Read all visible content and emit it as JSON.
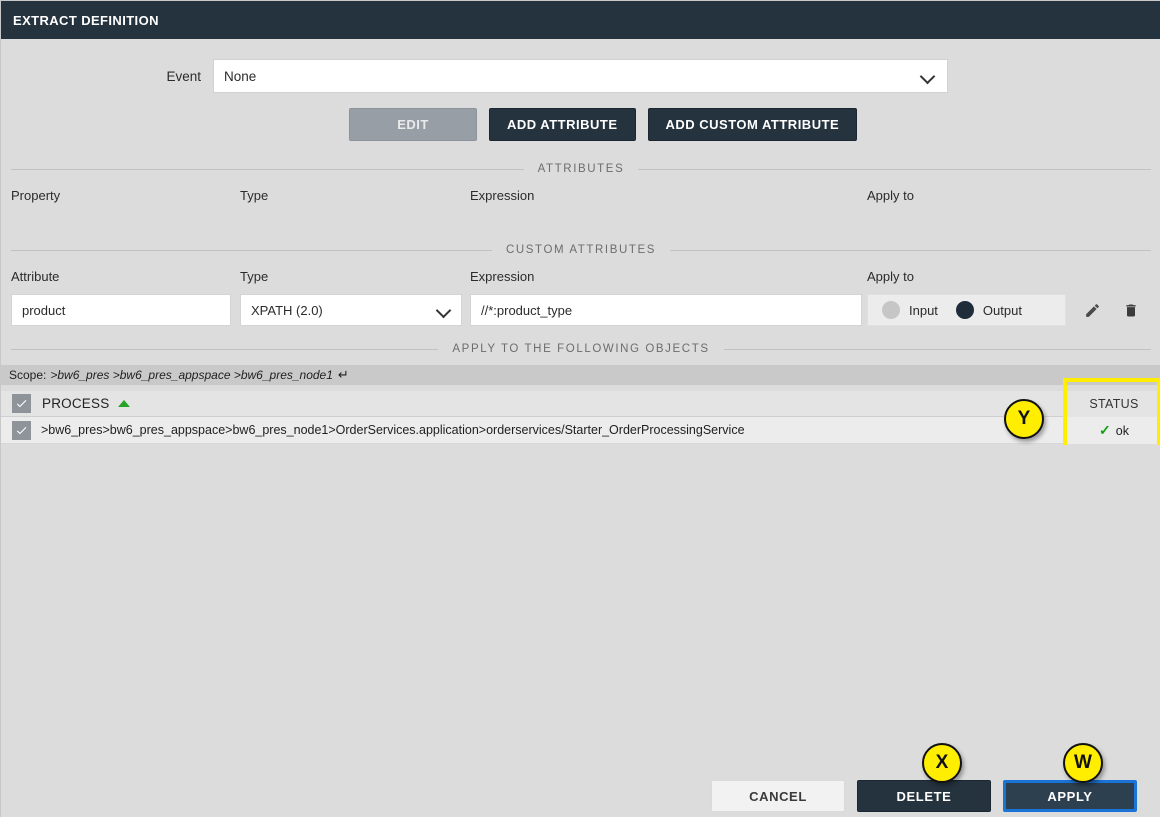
{
  "window": {
    "title": "EXTRACT DEFINITION"
  },
  "event": {
    "label": "Event",
    "value": "None",
    "chevron_icon": "chevron-down-icon"
  },
  "toolbar": {
    "edit_label": "EDIT",
    "add_attribute_label": "ADD ATTRIBUTE",
    "add_custom_attribute_label": "ADD CUSTOM ATTRIBUTE"
  },
  "attributes_section": {
    "caption": "ATTRIBUTES",
    "columns": [
      "Property",
      "Type",
      "Expression",
      "Apply to"
    ],
    "rows": []
  },
  "custom_attributes_section": {
    "caption": "CUSTOM ATTRIBUTES",
    "columns": [
      "Attribute",
      "Type",
      "Expression",
      "Apply to"
    ],
    "row": {
      "attribute": "product",
      "type": "XPATH (2.0)",
      "expression": "//*:product_type",
      "apply_to": {
        "input_label": "Input",
        "output_label": "Output",
        "selected": "Output"
      },
      "edit_icon": "pencil-icon",
      "delete_icon": "trash-icon"
    }
  },
  "apply_to_objects_section": {
    "caption": "APPLY TO THE FOLLOWING OBJECTS",
    "scope": {
      "label": "Scope:",
      "path": ">bw6_pres >bw6_pres_appspace >bw6_pres_node1",
      "return_icon": "↵"
    },
    "table": {
      "header": {
        "checkbox_checked": true,
        "label": "PROCESS",
        "sort_icon": "sort-ascending-icon",
        "status_label": "STATUS"
      },
      "rows": [
        {
          "checked": true,
          "path": ">bw6_pres>bw6_pres_appspace>bw6_pres_node1>OrderServices.application>orderservices/Starter_OrderProcessingService",
          "status_icon": "check-icon",
          "status": "ok"
        }
      ]
    }
  },
  "footer": {
    "cancel_label": "CANCEL",
    "delete_label": "DELETE",
    "apply_label": "APPLY"
  },
  "annotations": {
    "y": "Y",
    "x": "X",
    "w": "W"
  },
  "colors": {
    "titlebar": "#25333f",
    "accent_dark": "#25333f",
    "focus_blue": "#1a74d6",
    "annotation_yellow": "#ffee00",
    "status_green": "#12a012",
    "sort_green": "#27a427",
    "page_bg": "#dcdcdc"
  }
}
